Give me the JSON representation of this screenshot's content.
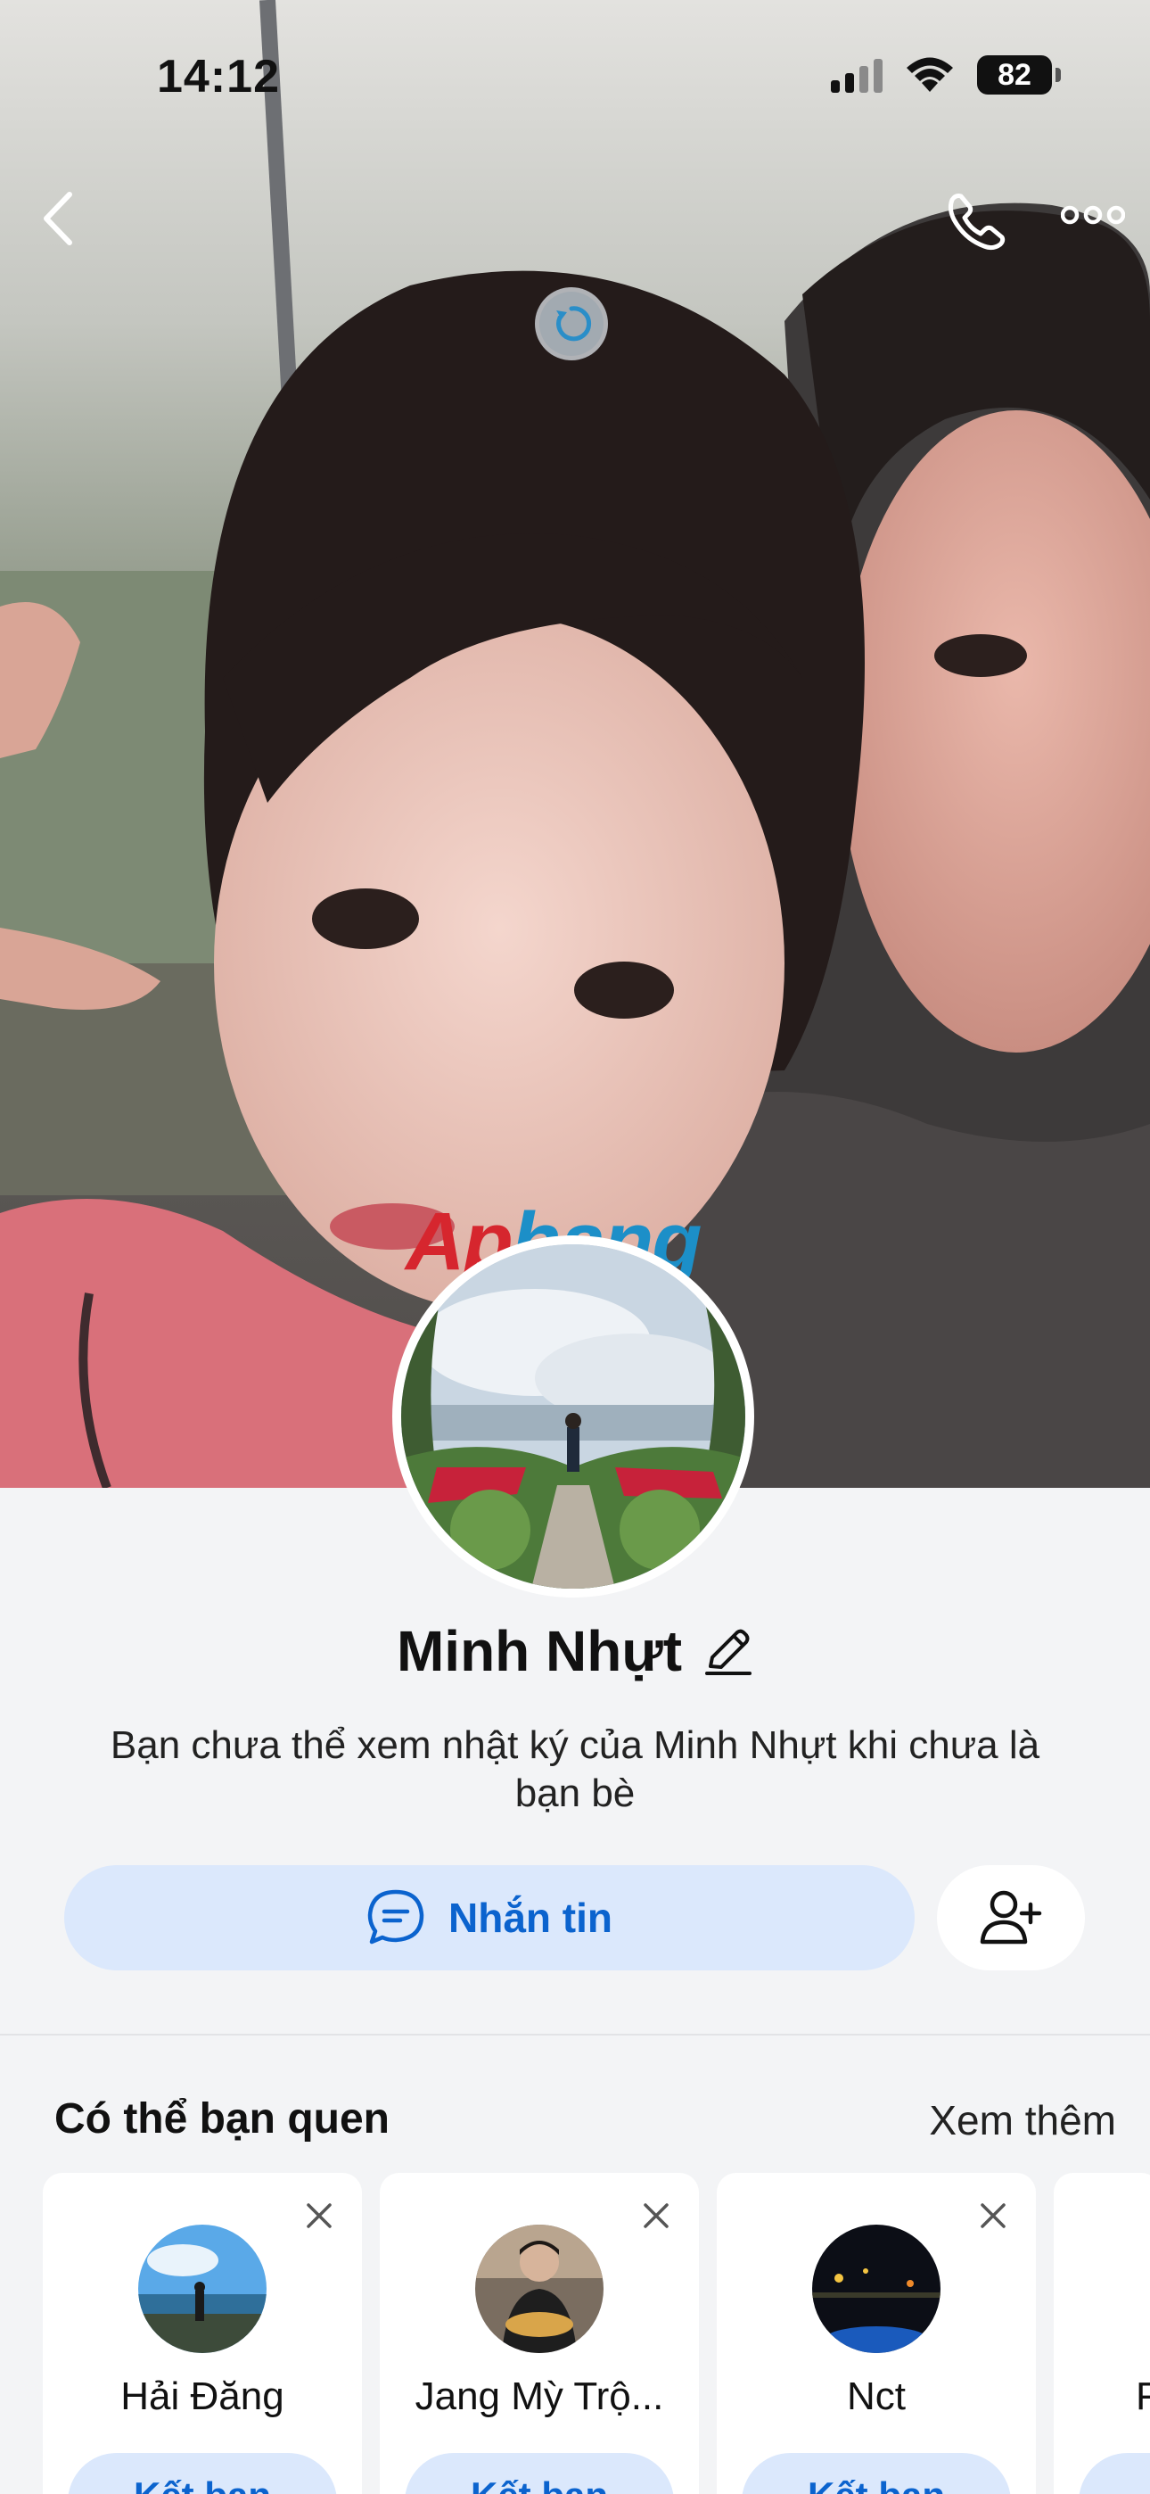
{
  "status_bar": {
    "time": "14:12",
    "battery": "82",
    "icons": [
      "signal-icon",
      "wifi-icon",
      "battery-icon"
    ]
  },
  "header": {
    "icons": [
      "back-icon",
      "phone-icon",
      "more-icon",
      "loading-icon"
    ]
  },
  "watermark": {
    "part1": "Ap",
    "part2": "hang"
  },
  "profile": {
    "name": "Minh Nhựt",
    "description": "Bạn chưa thể xem nhật ký của Minh Nhựt khi chưa là bạn bè",
    "message_button": "Nhắn tin"
  },
  "suggestions": {
    "title": "Có thể bạn quen",
    "see_more": "Xem thêm",
    "add_label": "Kết bạn",
    "items": [
      {
        "name": "Hải Đăng"
      },
      {
        "name": "Jang Mỳ Trộ..."
      },
      {
        "name": "Nct"
      },
      {
        "name": "F"
      }
    ]
  },
  "colors": {
    "accent": "#0b63ce",
    "accent_bg": "#dbe8fc",
    "background": "#f3f4f6"
  }
}
